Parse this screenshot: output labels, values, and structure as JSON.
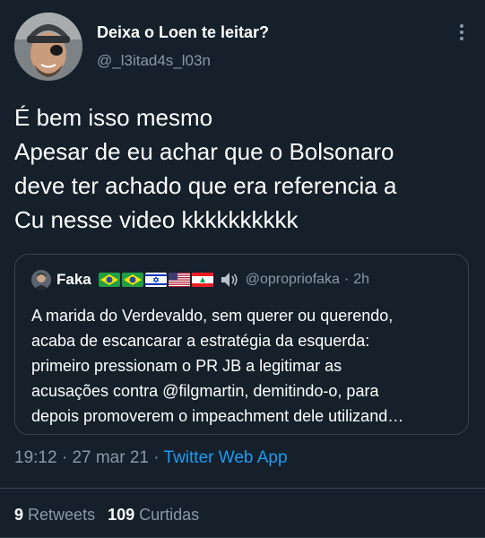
{
  "author": {
    "name": "Deixa o Loen te leitar?",
    "handle": "@_l3itad4s_l03n"
  },
  "tweet": {
    "lines": [
      "É bem isso mesmo",
      "Apesar de eu achar que o Bolsonaro",
      "deve ter achado que era referencia a",
      "Cu nesse video kkkkkkkkkk"
    ]
  },
  "quoted": {
    "name": "Faka",
    "handle": "@opropriofaka",
    "separator": "·",
    "time": "2h",
    "flags": [
      "brazil-flag-icon",
      "brazil-flag-icon",
      "israel-flag-icon",
      "usa-flag-icon",
      "lebanon-flag-icon"
    ],
    "lines": [
      "A marida do Verdevaldo, sem querer ou querendo,",
      "acaba de escancarar a estratégia da esquerda:",
      "primeiro pressionam o PR JB a legitimar as",
      "acusações contra @filgmartin, demitindo-o, para",
      "depois promoverem o impeachment dele utilizand…"
    ]
  },
  "meta": {
    "time": "19:12",
    "separator1": "·",
    "date": "27 mar 21",
    "separator2": "·",
    "app": "Twitter Web App"
  },
  "stats": {
    "retweets_count": "9",
    "retweets_label": "Retweets",
    "likes_count": "109",
    "likes_label": "Curtidas"
  },
  "colors": {
    "background": "#15202b",
    "secondary_text": "#8899a6",
    "link": "#1d9bf0",
    "border": "#38444d"
  }
}
